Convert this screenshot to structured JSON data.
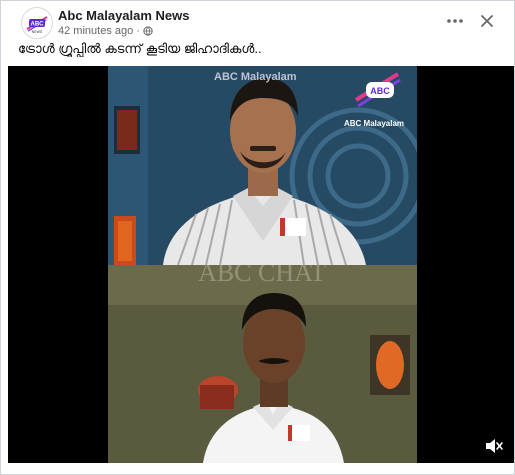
{
  "post": {
    "page_name": "Abc Malayalam News",
    "timestamp": "42 minutes ago",
    "separator": "·",
    "caption": "ട്രോൾ ഗ്രൂപ്പിൽ കടന്ന് കൂടിയ ജിഹാദികൾ..",
    "avatar_logo_text": "ABC",
    "avatar_sub_text": "NEWS"
  },
  "video": {
    "watermark_top": "ABC Malayalam",
    "logo_text": "ABC",
    "logo_caption": "ABC Malayalam",
    "watermark_mid": "ABC CHAT"
  },
  "icons": {
    "more": "more-icon",
    "close": "close-icon",
    "globe": "globe-icon",
    "volume": "volume-muted-icon"
  },
  "colors": {
    "text_primary": "#1c1e21",
    "text_secondary": "#65676b",
    "video_bg": "#000000",
    "brand_accent": "#e23a8a"
  }
}
